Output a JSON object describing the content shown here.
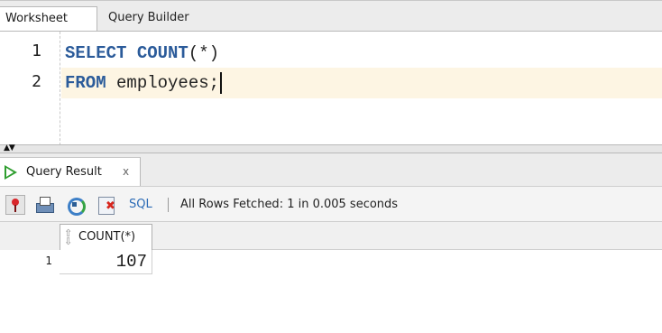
{
  "tabs": {
    "worksheet": "Worksheet",
    "query_builder": "Query Builder"
  },
  "editor": {
    "line_numbers": [
      "1",
      "2"
    ],
    "line1": {
      "keyword1": "SELECT",
      "keyword2": "COUNT",
      "rest": "(*)"
    },
    "line2": {
      "keyword": "FROM",
      "rest": "employees;"
    }
  },
  "result_panel": {
    "tab_label": "Query Result",
    "close_glyph": "x",
    "toolbar": {
      "sql_label": "SQL",
      "status": "All Rows Fetched: 1 in 0.005 seconds"
    },
    "grid": {
      "columns": [
        "COUNT(*)"
      ],
      "rows": [
        {
          "row_number": "1",
          "cells": [
            "107"
          ]
        }
      ]
    }
  },
  "colors": {
    "keyword": "#2b5b9a",
    "current_line": "#fdf5e3",
    "run_icon": "#2f9e2f",
    "link": "#2b6bb6"
  },
  "icons": [
    "play-icon",
    "pin-icon",
    "print-icon",
    "refresh-icon",
    "cancel-fetch-icon",
    "sort-icon",
    "splitter-arrows-icon"
  ]
}
